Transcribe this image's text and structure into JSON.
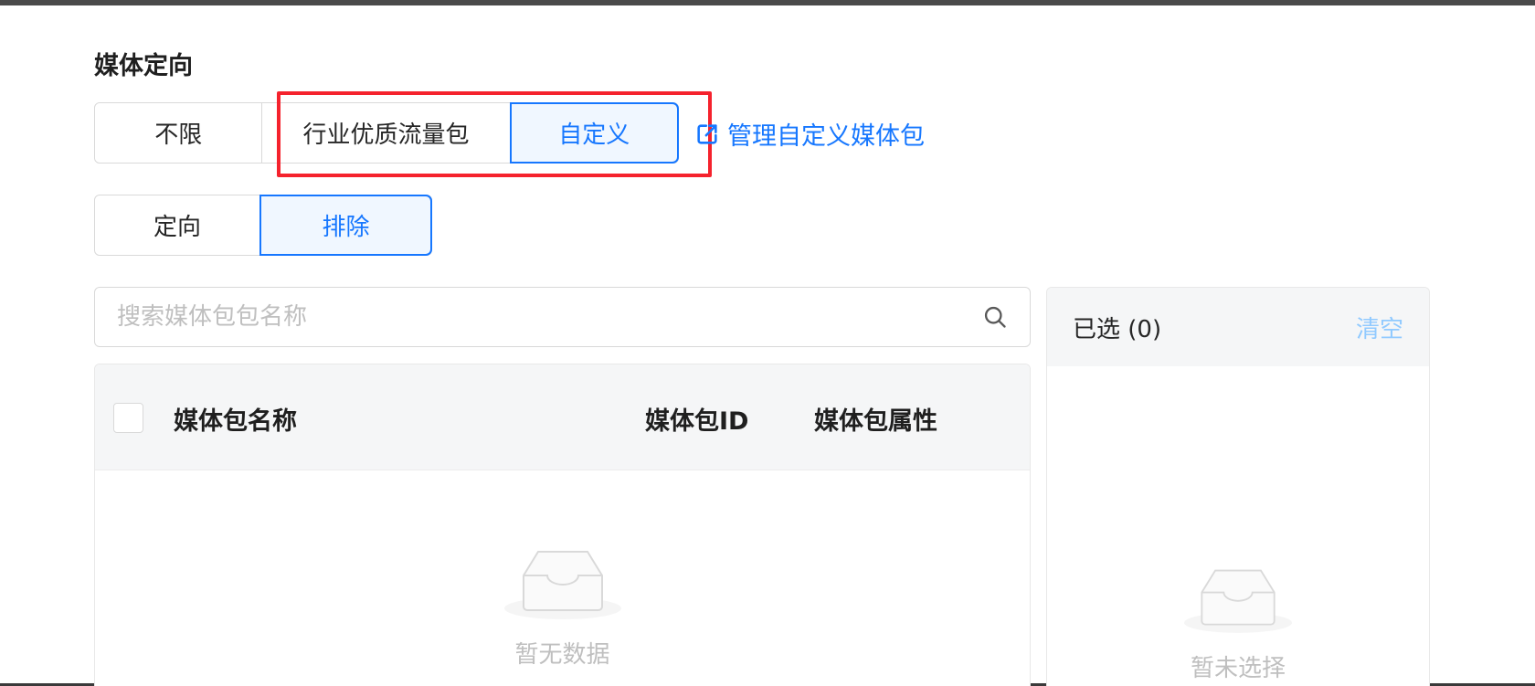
{
  "section": {
    "title": "媒体定向"
  },
  "media_options": [
    {
      "label": "不限",
      "active": false
    },
    {
      "label": "行业优质流量包",
      "active": false
    },
    {
      "label": "自定义",
      "active": true
    }
  ],
  "manage_link": {
    "label": "管理自定义媒体包",
    "icon": "external-link-icon"
  },
  "mode_options": [
    {
      "label": "定向",
      "active": false
    },
    {
      "label": "排除",
      "active": true
    }
  ],
  "search": {
    "placeholder": "搜索媒体包包名称",
    "icon": "search-icon"
  },
  "table": {
    "columns": [
      "媒体包名称",
      "媒体包ID",
      "媒体包属性"
    ],
    "rows": [],
    "empty_text": "暂无数据",
    "empty_icon": "inbox-icon"
  },
  "selected": {
    "title": "已选 (0)",
    "clear_label": "清空",
    "empty_text": "暂未选择",
    "empty_icon": "inbox-icon"
  },
  "colors": {
    "accent": "#1677ff",
    "highlight": "#f5222d",
    "clear_link": "#91caff"
  }
}
